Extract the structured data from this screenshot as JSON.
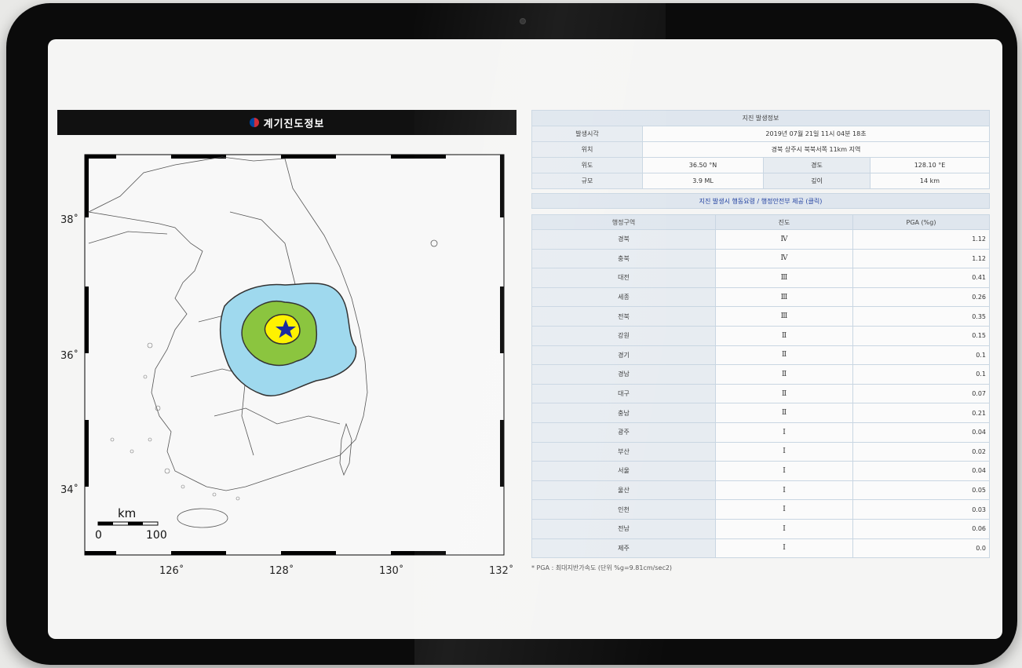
{
  "map": {
    "title": "계기진도정보",
    "lat_labels": [
      "38˚",
      "36˚",
      "34˚"
    ],
    "lon_labels": [
      "126˚",
      "128˚",
      "130˚",
      "132˚"
    ],
    "scale": {
      "unit": "km",
      "start": "0",
      "end": "100"
    },
    "colors": {
      "intensity_2": "#9fd9ee",
      "intensity_3": "#8bc53f",
      "intensity_4": "#fff200",
      "epicenter": "#1a2aa0"
    }
  },
  "info": {
    "title": "지진 발생정보",
    "time_label": "발생시각",
    "time_value": "2019년 07월 21일 11시 04분 18초",
    "location_label": "위치",
    "location_value": "경북 상주시 북북서쪽 11km 지역",
    "lat_label": "위도",
    "lat_value": "36.50 °N",
    "lon_label": "경도",
    "lon_value": "128.10 °E",
    "magnitude_label": "규모",
    "magnitude_value": "3.9 ML",
    "depth_label": "깊이",
    "depth_value": "14 km"
  },
  "banner": "지진 발생시 행동요령 / 행정안전부 제공 (클릭)",
  "region_table": {
    "headers": [
      "행정구역",
      "진도",
      "PGA (%g)"
    ],
    "rows": [
      {
        "region": "경북",
        "intensity": "Ⅳ",
        "pga": "1.12"
      },
      {
        "region": "충북",
        "intensity": "Ⅳ",
        "pga": "1.12"
      },
      {
        "region": "대전",
        "intensity": "Ⅲ",
        "pga": "0.41"
      },
      {
        "region": "세종",
        "intensity": "Ⅲ",
        "pga": "0.26"
      },
      {
        "region": "전북",
        "intensity": "Ⅲ",
        "pga": "0.35"
      },
      {
        "region": "강원",
        "intensity": "Ⅱ",
        "pga": "0.15"
      },
      {
        "region": "경기",
        "intensity": "Ⅱ",
        "pga": "0.1"
      },
      {
        "region": "경남",
        "intensity": "Ⅱ",
        "pga": "0.1"
      },
      {
        "region": "대구",
        "intensity": "Ⅱ",
        "pga": "0.07"
      },
      {
        "region": "충남",
        "intensity": "Ⅱ",
        "pga": "0.21"
      },
      {
        "region": "광주",
        "intensity": "Ⅰ",
        "pga": "0.04"
      },
      {
        "region": "부산",
        "intensity": "Ⅰ",
        "pga": "0.02"
      },
      {
        "region": "서울",
        "intensity": "Ⅰ",
        "pga": "0.04"
      },
      {
        "region": "울산",
        "intensity": "Ⅰ",
        "pga": "0.05"
      },
      {
        "region": "인천",
        "intensity": "Ⅰ",
        "pga": "0.03"
      },
      {
        "region": "전남",
        "intensity": "Ⅰ",
        "pga": "0.06"
      },
      {
        "region": "제주",
        "intensity": "Ⅰ",
        "pga": "0.0"
      }
    ]
  },
  "footnote": "* PGA : 최대지반가속도 (단위 %g=9.81cm/sec2)"
}
